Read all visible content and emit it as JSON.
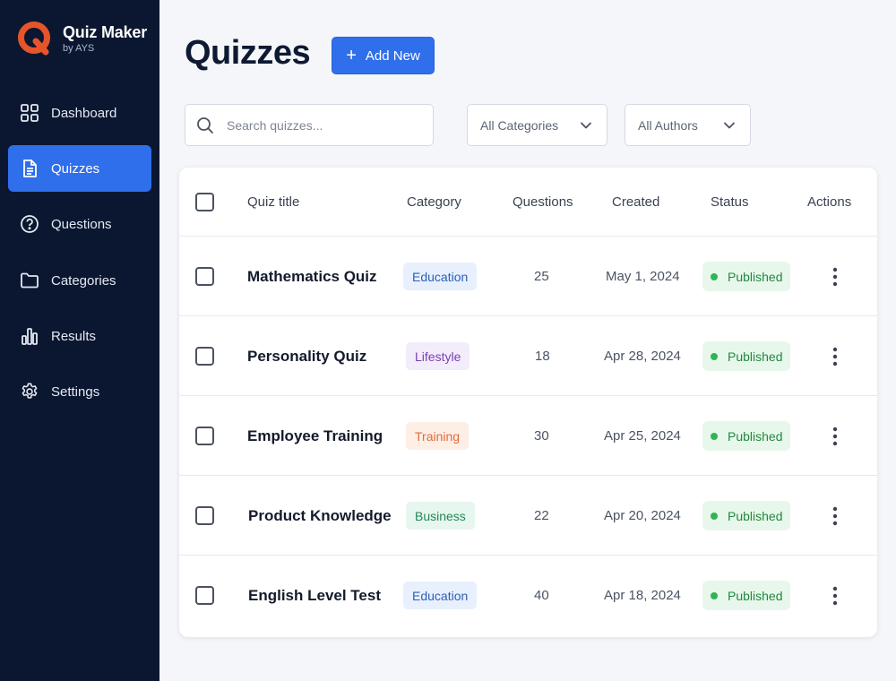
{
  "brand": {
    "name": "Quiz Maker",
    "sub": "by AYS",
    "accent": "#e8542a"
  },
  "sidebar": {
    "items": [
      {
        "label": "Dashboard",
        "icon": "grid-icon",
        "active": false
      },
      {
        "label": "Quizzes",
        "icon": "document-icon",
        "active": true
      },
      {
        "label": "Questions",
        "icon": "question-circle-icon",
        "active": false
      },
      {
        "label": "Categories",
        "icon": "folder-icon",
        "active": false
      },
      {
        "label": "Results",
        "icon": "bar-chart-icon",
        "active": false
      },
      {
        "label": "Settings",
        "icon": "gear-icon",
        "active": false
      }
    ]
  },
  "header": {
    "title": "Quizzes",
    "add_label": "Add New"
  },
  "filters": {
    "search_placeholder": "Search quizzes...",
    "category": "All Categories",
    "author": "All Authors"
  },
  "table": {
    "columns": [
      "Quiz title",
      "Category",
      "Questions",
      "Created",
      "Status",
      "Actions"
    ],
    "rows": [
      {
        "title": "Mathematics Quiz",
        "category": "Education",
        "questions": "25",
        "created": "May 1, 2024",
        "status": "Published"
      },
      {
        "title": "Personality Quiz",
        "category": "Lifestyle",
        "questions": "18",
        "created": "Apr 28, 2024",
        "status": "Published"
      },
      {
        "title": "Employee Training",
        "category": "Training",
        "questions": "30",
        "created": "Apr 25, 2024",
        "status": "Published"
      },
      {
        "title": "Product Knowledge",
        "category": "Business",
        "questions": "22",
        "created": "Apr 20, 2024",
        "status": "Published"
      },
      {
        "title": "English Level Test",
        "category": "Education",
        "questions": "40",
        "created": "Apr 18, 2024",
        "status": "Published"
      }
    ]
  },
  "colors": {
    "sidebar_bg": "#0b1730",
    "primary": "#2f6fec",
    "badge_education": {
      "bg": "#e8f0fd",
      "fg": "#2c5fb8"
    },
    "badge_lifestyle": {
      "bg": "#f3ecfb",
      "fg": "#7b3fb0"
    },
    "badge_training": {
      "bg": "#fdeee6",
      "fg": "#e56b3a"
    },
    "badge_business": {
      "bg": "#e7f6ee",
      "fg": "#23885a"
    },
    "status_published": "#2fb553"
  }
}
